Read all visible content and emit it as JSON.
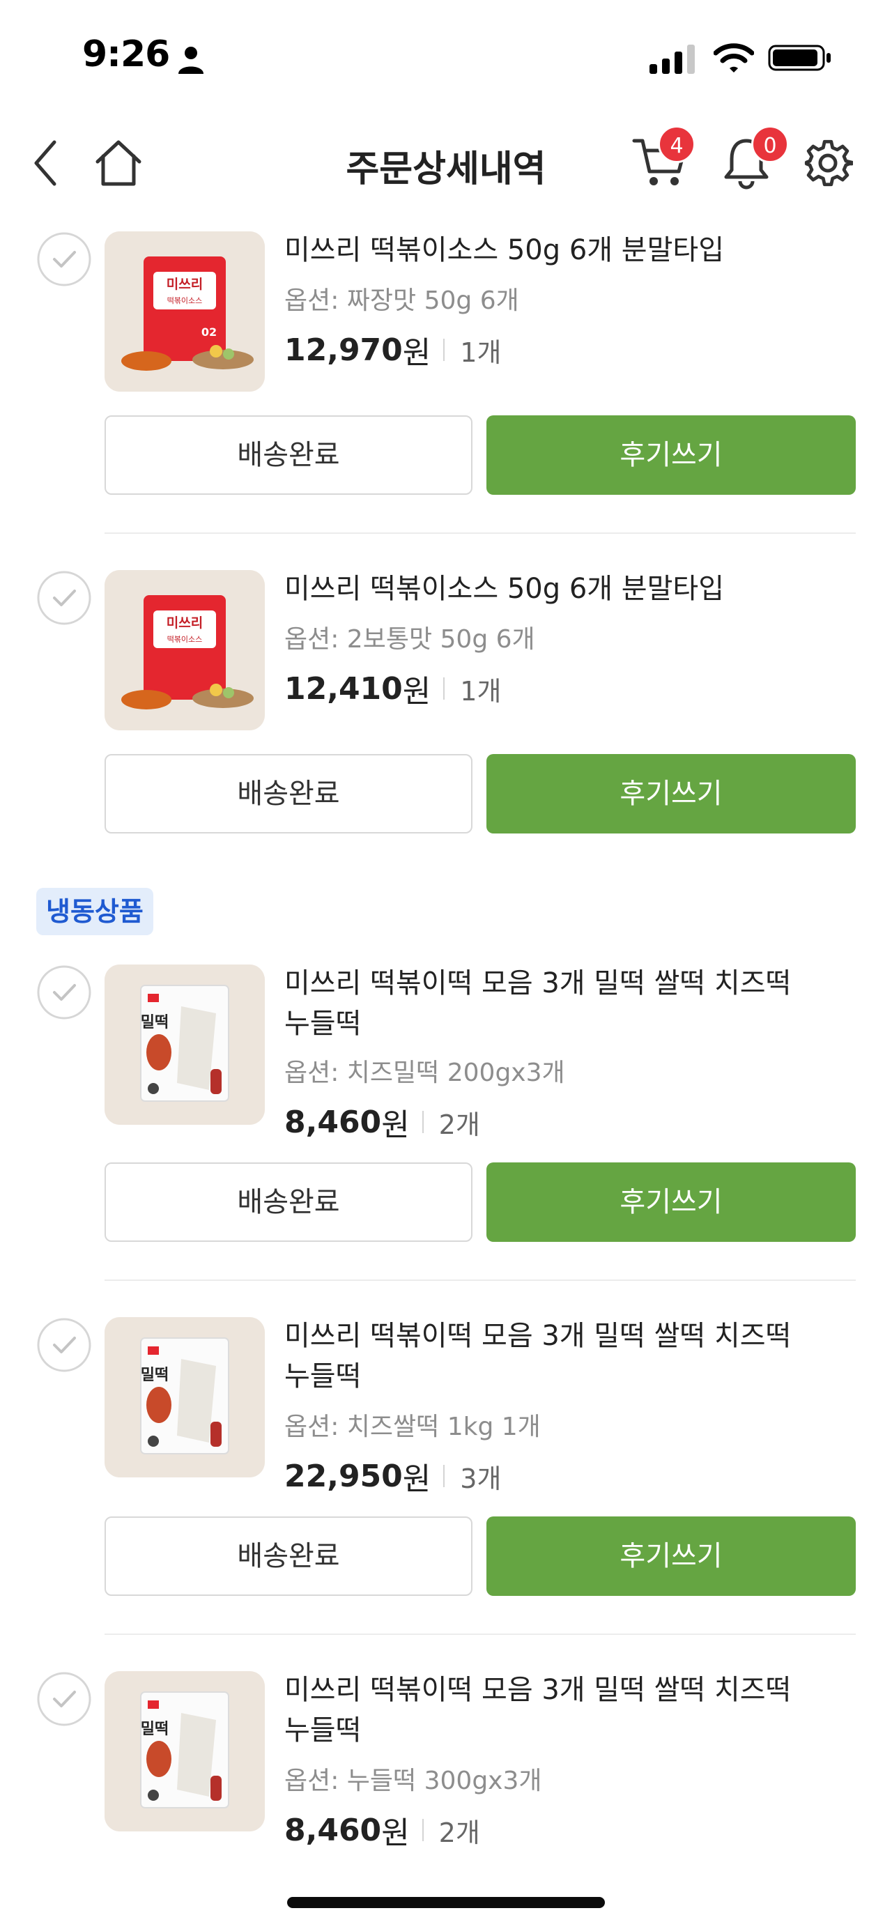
{
  "status_bar": {
    "time": "9:26"
  },
  "header": {
    "title": "주문상세내역",
    "cart_count": "4",
    "notification_count": "0"
  },
  "won_suffix": "원",
  "items": [
    {
      "name": "미쓰리 떡볶이소스 50g 6개 분말타입",
      "option": "옵션: 짜장맛 50g 6개",
      "price": "12,970",
      "qty": "1개",
      "status": "배송완료",
      "review": "후기쓰기"
    },
    {
      "name": "미쓰리 떡볶이소스 50g 6개 분말타입",
      "option": "옵션: 2보통맛 50g 6개",
      "price": "12,410",
      "qty": "1개",
      "status": "배송완료",
      "review": "후기쓰기"
    },
    {
      "name": "미쓰리 떡볶이떡 모음 3개 밀떡 쌀떡 치즈떡 누들떡",
      "option": "옵션: 치즈밀떡 200gx3개",
      "price": "8,460",
      "qty": "2개",
      "status": "배송완료",
      "review": "후기쓰기"
    },
    {
      "name": "미쓰리 떡볶이떡 모음 3개 밀떡 쌀떡 치즈떡 누들떡",
      "option": "옵션: 치즈쌀떡 1kg 1개",
      "price": "22,950",
      "qty": "3개",
      "status": "배송완료",
      "review": "후기쓰기"
    },
    {
      "name": "미쓰리 떡볶이떡 모음 3개 밀떡 쌀떡 치즈떡 누들떡",
      "option": "옵션: 누들떡 300gx3개",
      "price": "8,460",
      "qty": "2개"
    }
  ],
  "section_badge": "냉동상품",
  "product_images": {
    "sauce_brand": "미쓰리",
    "sauce_sub": "떡볶이소스",
    "sauce_no": "02",
    "rice_cake_label": "밀떡"
  },
  "colors": {
    "accent_green": "#65a542",
    "badge_red": "#e8343c",
    "frozen_blue": "#1f5ad1"
  }
}
